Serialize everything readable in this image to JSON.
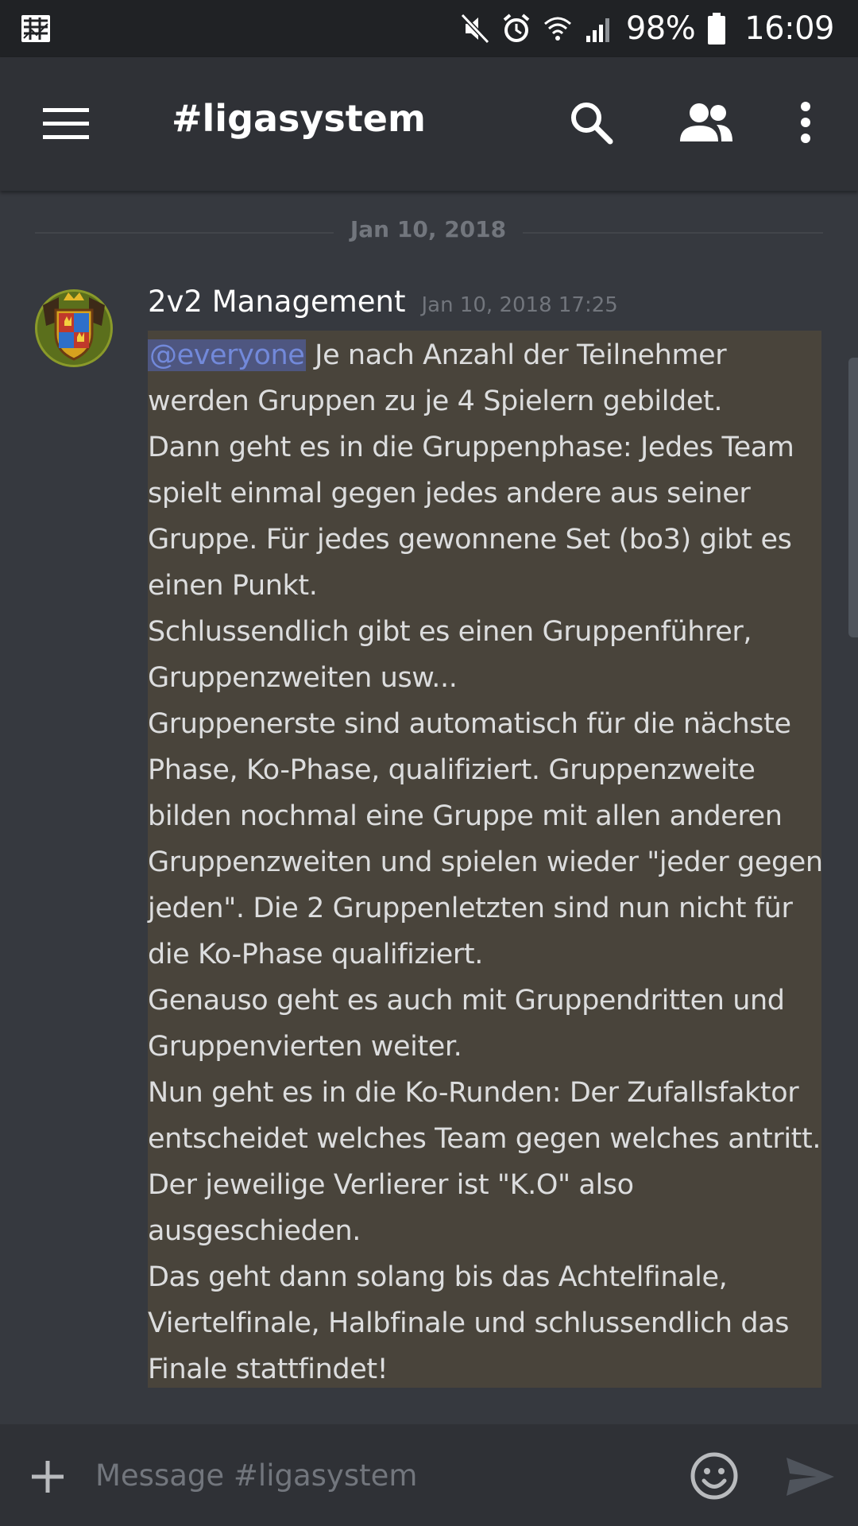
{
  "status_bar": {
    "battery_text": "98%",
    "time": "16:09",
    "icons": [
      "notification-app-icon",
      "mute-icon",
      "alarm-icon",
      "wifi-icon",
      "signal-icon",
      "battery-icon"
    ]
  },
  "header": {
    "channel_title": "#ligasystem",
    "icons": [
      "hamburger-menu-icon",
      "search-icon",
      "members-icon",
      "more-vert-icon"
    ]
  },
  "divider": {
    "date": "Jan 10, 2018"
  },
  "message": {
    "author": "2v2 Management",
    "timestamp": "Jan 10, 2018 17:25",
    "mention": "@everyone",
    "first_line_rest": " Je nach Anzahl der Teilnehmer",
    "lines": [
      "werden Gruppen zu je 4 Spielern gebildet.",
      "Dann geht es in die Gruppenphase: Jedes Team",
      "spielt einmal gegen jedes andere aus seiner",
      "Gruppe. Für jedes gewonnene Set (bo3) gibt es",
      "einen Punkt.",
      "Schlussendlich gibt es einen Gruppenführer,",
      "Gruppenzweiten usw...",
      "Gruppenerste sind automatisch für die nächste",
      "Phase, Ko-Phase, qualifiziert. Gruppenzweite",
      "bilden nochmal eine Gruppe mit allen anderen",
      "Gruppenzweiten und spielen wieder \"jeder gegen",
      "jeden\". Die 2 Gruppenletzten sind nun nicht für",
      "die Ko-Phase qualifiziert.",
      "Genauso geht es auch mit Gruppendritten und",
      "Gruppenvierten weiter.",
      "Nun geht es in die Ko-Runden: Der Zufallsfaktor",
      "entscheidet welches Team gegen welches antritt.",
      "Der jeweilige Verlierer ist \"K.O\" also",
      "ausgeschieden.",
      "Das geht dann solang bis das Achtelfinale,",
      "Viertelfinale, Halbfinale und schlussendlich das",
      "Finale stattfindet!"
    ]
  },
  "composer": {
    "placeholder": "Message #ligasystem",
    "value": ""
  },
  "colors": {
    "background": "#36393f",
    "header": "#2f3136",
    "status_bar": "#202225",
    "highlight": "#49443b",
    "mention": "#7289da"
  }
}
